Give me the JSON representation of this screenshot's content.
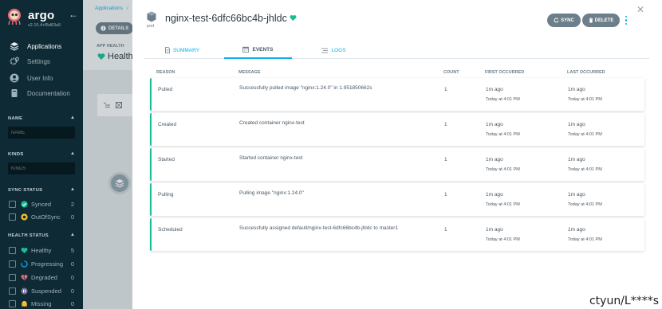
{
  "sidebar": {
    "brand": "argo",
    "version": "v2.10.4+f5d63a5",
    "nav": [
      {
        "label": "Applications",
        "icon": "layers-icon",
        "active": true
      },
      {
        "label": "Settings",
        "icon": "gears-icon",
        "active": false
      },
      {
        "label": "User Info",
        "icon": "user-circle-icon",
        "active": false
      },
      {
        "label": "Documentation",
        "icon": "book-icon",
        "active": false
      }
    ],
    "name_section": {
      "title": "NAME",
      "placeholder": "NAME"
    },
    "kinds_section": {
      "title": "KINDS",
      "placeholder": "KINDS"
    },
    "sync_status": {
      "title": "SYNC STATUS",
      "items": [
        {
          "label": "Synced",
          "count": "2",
          "icon": "check-circle-icon",
          "color": "#18be94"
        },
        {
          "label": "OutOfSync",
          "count": "0",
          "icon": "arrow-circle-icon",
          "color": "#f4c030"
        }
      ]
    },
    "health_status": {
      "title": "HEALTH STATUS",
      "items": [
        {
          "label": "Healthy",
          "count": "5",
          "icon": "heart-icon",
          "color": "#18be94"
        },
        {
          "label": "Progressing",
          "count": "0",
          "icon": "circle-notch-icon",
          "color": "#0dadea"
        },
        {
          "label": "Degraded",
          "count": "0",
          "icon": "heart-broken-icon",
          "color": "#e96d76"
        },
        {
          "label": "Suspended",
          "count": "0",
          "icon": "pause-circle-icon",
          "color": "#766f94"
        },
        {
          "label": "Missing",
          "count": "0",
          "icon": "ghost-icon",
          "color": "#f4c030"
        }
      ]
    }
  },
  "background": {
    "breadcrumb": "Applications",
    "breadcrumb_sep": "/",
    "details_button": "DETAILS",
    "app_health_title": "APP HEALTH",
    "app_health_value": "Healthy"
  },
  "panel": {
    "kind_label": "pod",
    "title": "nginx-test-6dfc66bc4b-jhldc",
    "sync_button": "SYNC",
    "delete_button": "DELETE",
    "tabs": [
      {
        "label": "SUMMARY",
        "icon": "file-icon",
        "active": false
      },
      {
        "label": "EVENTS",
        "icon": "calendar-icon",
        "active": true
      },
      {
        "label": "LOGS",
        "icon": "list-icon",
        "active": false
      }
    ],
    "columns": {
      "reason": "REASON",
      "message": "MESSAGE",
      "count": "COUNT",
      "first": "FIRST OCCURRED",
      "last": "LAST OCCURRED"
    },
    "events": [
      {
        "reason": "Pulled",
        "message": "Successfully pulled image \"nginx:1.24.0\" in 1.951850662s",
        "count": "1",
        "first": "1m ago",
        "first_time": "Today at 4:01 PM",
        "last": "1m ago",
        "last_time": "Today at 4:01 PM"
      },
      {
        "reason": "Created",
        "message": "Created container nginx-test",
        "count": "1",
        "first": "1m ago",
        "first_time": "Today at 4:01 PM",
        "last": "1m ago",
        "last_time": "Today at 4:01 PM"
      },
      {
        "reason": "Started",
        "message": "Started container nginx-test",
        "count": "1",
        "first": "1m ago",
        "first_time": "Today at 4:01 PM",
        "last": "1m ago",
        "last_time": "Today at 4:01 PM"
      },
      {
        "reason": "Pulling",
        "message": "Pulling image \"nginx:1.24.0\"",
        "count": "1",
        "first": "1m ago",
        "first_time": "Today at 4:01 PM",
        "last": "1m ago",
        "last_time": "Today at 4:01 PM"
      },
      {
        "reason": "Scheduled",
        "message": "Successfully assigned default/nginx-test-6dfc66bc4b-jhldc to master1",
        "count": "1",
        "first": "1m ago",
        "first_time": "Today at 4:01 PM",
        "last": "1m ago",
        "last_time": "Today at 4:01 PM"
      }
    ]
  },
  "watermark": "ctyun/L****s",
  "colors": {
    "accent": "#0dadea",
    "healthy": "#18be94",
    "sidebar_bg": "#0e2a35",
    "button_bg": "#6d7f8b"
  }
}
